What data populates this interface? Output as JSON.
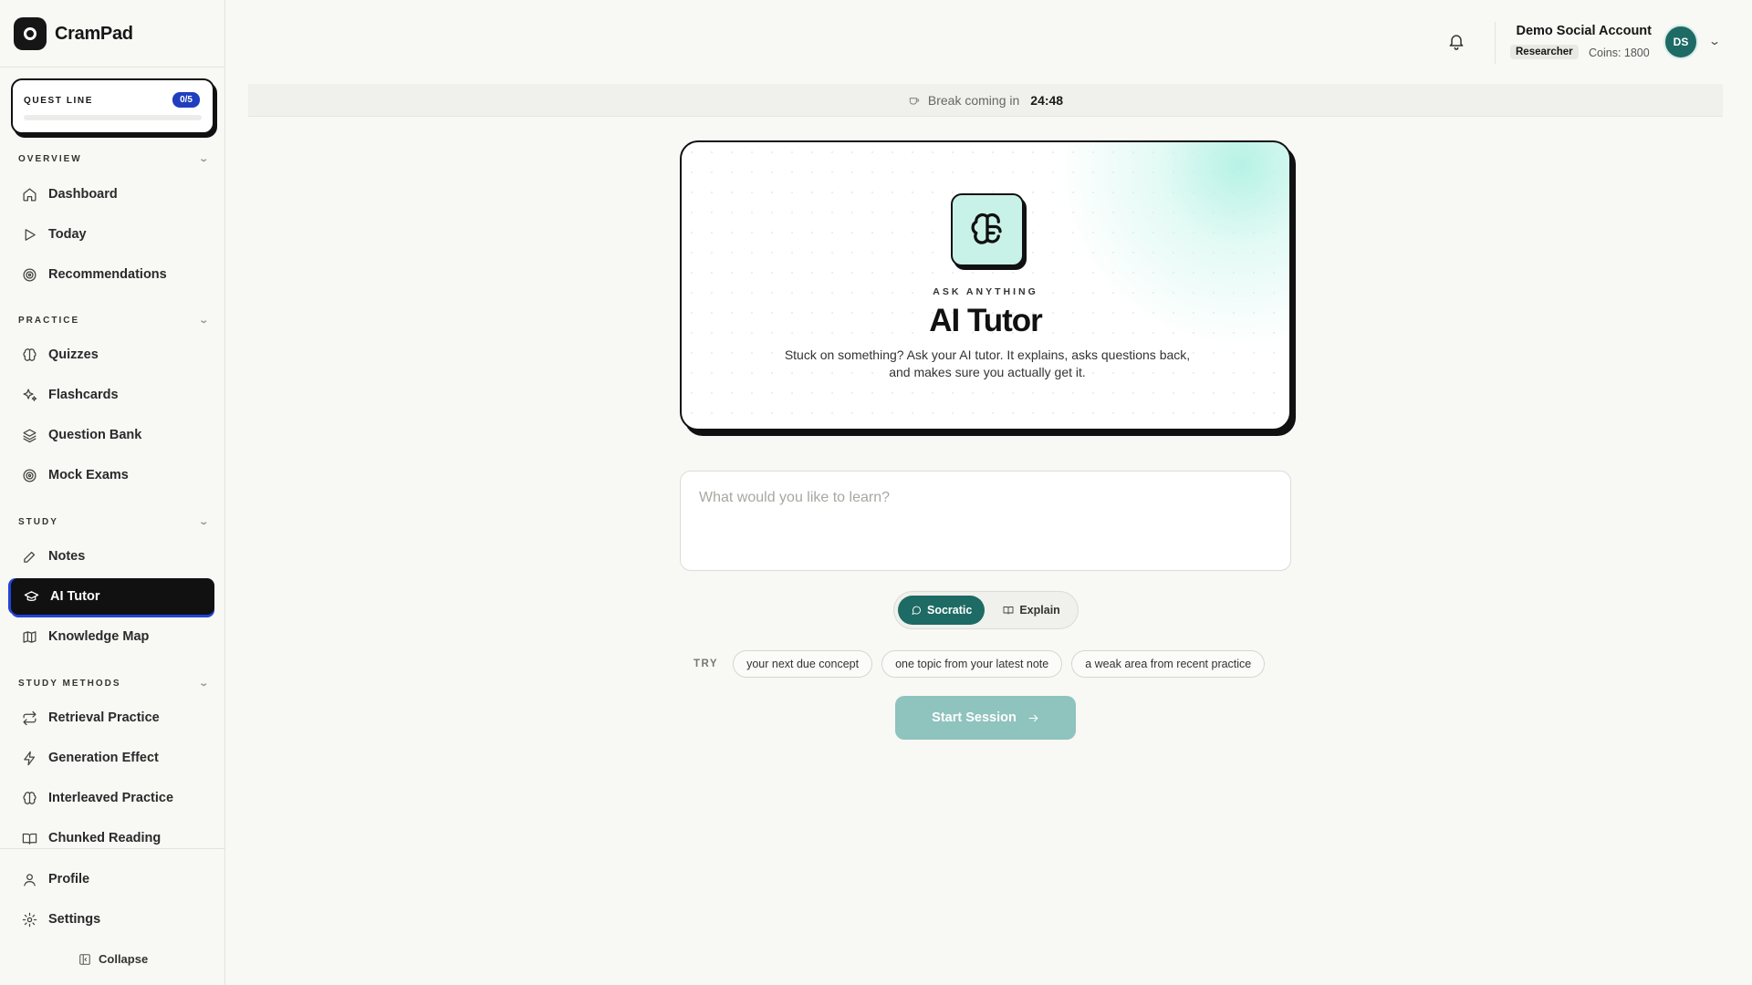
{
  "brand": {
    "name": "CramPad"
  },
  "quest": {
    "label": "QUEST LINE",
    "progress": "0/5",
    "progress_fraction": 0
  },
  "sidebar": {
    "sections": [
      {
        "title": "OVERVIEW",
        "items": [
          {
            "label": "Dashboard",
            "icon": "home-icon"
          },
          {
            "label": "Today",
            "icon": "play-icon"
          },
          {
            "label": "Recommendations",
            "icon": "target-icon"
          }
        ]
      },
      {
        "title": "PRACTICE",
        "items": [
          {
            "label": "Quizzes",
            "icon": "brain-icon"
          },
          {
            "label": "Flashcards",
            "icon": "sparkles-icon"
          },
          {
            "label": "Question Bank",
            "icon": "layers-icon"
          },
          {
            "label": "Mock Exams",
            "icon": "target-icon"
          }
        ]
      },
      {
        "title": "STUDY",
        "items": [
          {
            "label": "Notes",
            "icon": "pencil-icon"
          },
          {
            "label": "AI Tutor",
            "icon": "graduation-cap-icon",
            "active": true
          },
          {
            "label": "Knowledge Map",
            "icon": "map-icon"
          }
        ]
      },
      {
        "title": "STUDY METHODS",
        "items": [
          {
            "label": "Retrieval Practice",
            "icon": "repeat-icon"
          },
          {
            "label": "Generation Effect",
            "icon": "zap-icon"
          },
          {
            "label": "Interleaved Practice",
            "icon": "brain-icon"
          },
          {
            "label": "Chunked Reading",
            "icon": "book-open-icon"
          }
        ]
      }
    ],
    "bottom": [
      {
        "label": "Profile",
        "icon": "user-icon"
      },
      {
        "label": "Settings",
        "icon": "gear-icon"
      }
    ],
    "collapse_label": "Collapse"
  },
  "header": {
    "user_name": "Demo Social Account",
    "role": "Researcher",
    "coins": "Coins: 1800",
    "avatar_initials": "DS"
  },
  "break_bar": {
    "label": "Break coming in",
    "time": "24:48"
  },
  "hero": {
    "eyebrow": "ASK ANYTHING",
    "title": "AI Tutor",
    "description": "Stuck on something? Ask your AI tutor. It explains, asks questions back, and makes sure you actually get it."
  },
  "prompt": {
    "placeholder": "What would you like to learn?",
    "value": ""
  },
  "modes": {
    "socratic": "Socratic",
    "explain": "Explain",
    "selected": "Socratic"
  },
  "try": {
    "label": "TRY",
    "chips": [
      "your next due concept",
      "one topic from your latest note",
      "a weak area from recent practice"
    ]
  },
  "start_button": {
    "label": "Start Session"
  },
  "colors": {
    "accent": "#1d6b64",
    "accent_disabled": "#8fc3bd",
    "quest_badge": "#1f3fbf",
    "active_nav": "#111111"
  }
}
